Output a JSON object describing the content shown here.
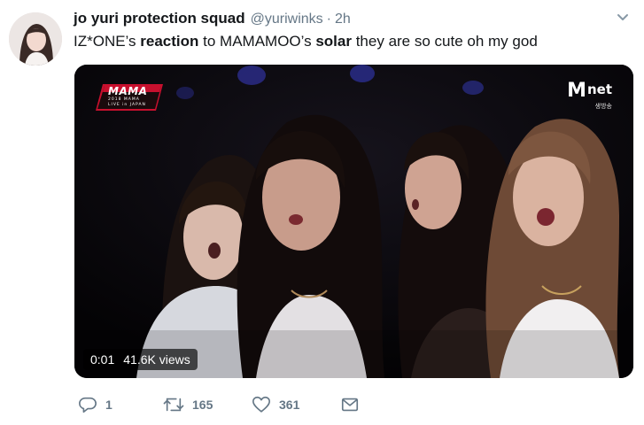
{
  "tweet": {
    "display_name": "jo yuri protection squad",
    "handle": "@yuriwinks",
    "separator": "·",
    "time": "2h",
    "text": {
      "part1": "IZ*ONE’s ",
      "bold1": "reaction",
      "part2": " to MAMAMOO’s ",
      "bold2": "solar",
      "part3": " they are so cute oh my god"
    }
  },
  "media": {
    "broadcast_logo": {
      "title": "MAMA",
      "line1": "2018 MAMA",
      "line2": "LIVE in JAPAN"
    },
    "channel_logo": {
      "m": "M",
      "net": "net",
      "subtitle": "생방송"
    },
    "duration": "0:01",
    "views": "41.6K views"
  },
  "actions": {
    "reply_count": "1",
    "retweet_count": "165",
    "like_count": "361"
  },
  "icons": {
    "reply": "reply-icon",
    "retweet": "retweet-icon",
    "like": "heart-icon",
    "dm": "envelope-icon",
    "more": "chevron-down-icon"
  },
  "colors": {
    "text": "#14171a",
    "secondary": "#657786",
    "logo_red": "#c8102e"
  }
}
